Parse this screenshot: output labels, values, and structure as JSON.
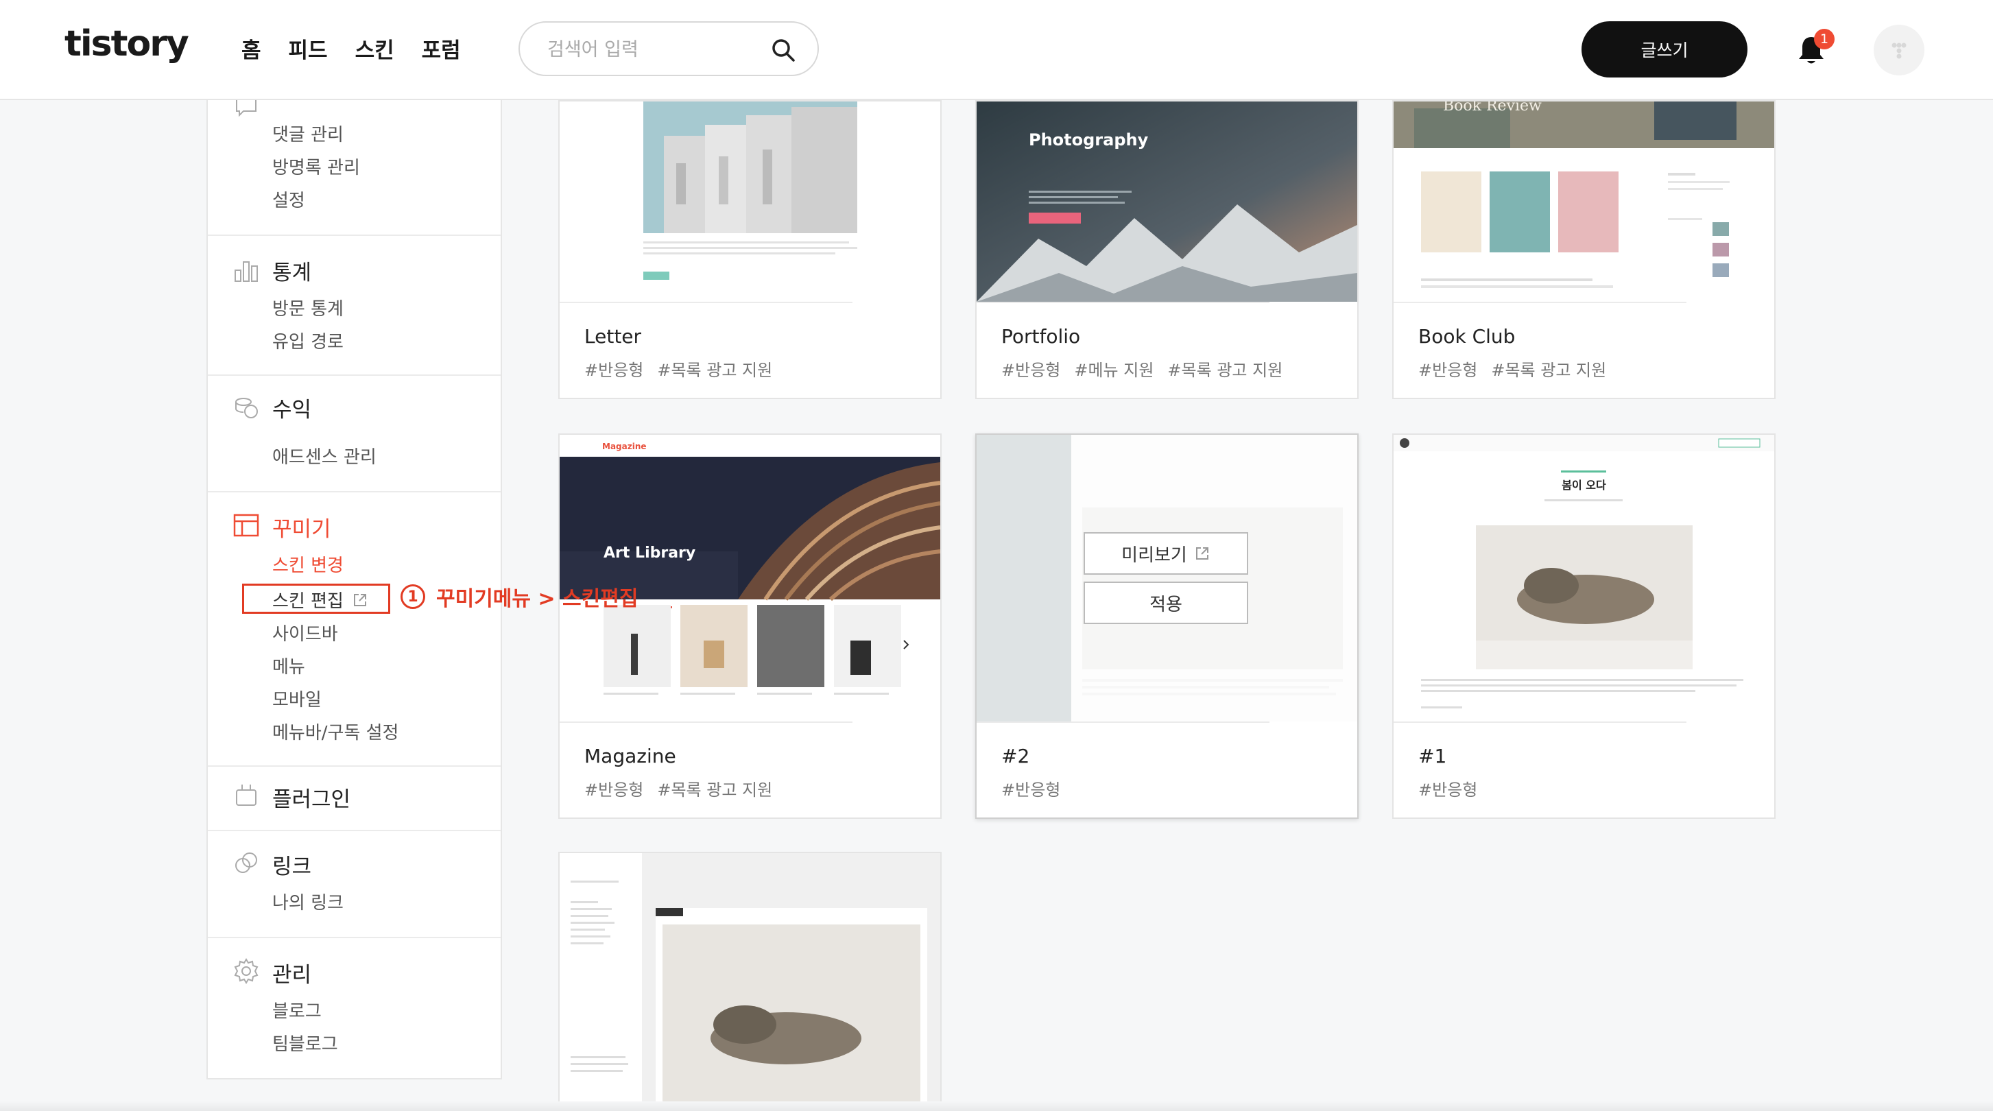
{
  "header": {
    "logo": "tistory",
    "nav": [
      "홈",
      "피드",
      "스킨",
      "포럼"
    ],
    "search_placeholder": "검색어 입력",
    "write_label": "글쓰기",
    "notification_count": "1"
  },
  "sidebar": {
    "top_items": [
      "댓글 관리",
      "방명록 관리",
      "설정"
    ],
    "groups": [
      {
        "title": "통계",
        "items": [
          "방문 통계",
          "유입 경로"
        ]
      },
      {
        "title": "수익",
        "items": [
          "애드센스 관리"
        ]
      },
      {
        "title": "꾸미기",
        "items": [
          "스킨 변경",
          "스킨 편집",
          "사이드바",
          "메뉴",
          "모바일",
          "메뉴바/구독 설정"
        ]
      },
      {
        "title": "플러그인",
        "items": []
      },
      {
        "title": "링크",
        "items": [
          "나의 링크"
        ]
      },
      {
        "title": "관리",
        "items": [
          "블로그",
          "팀블로그"
        ]
      }
    ]
  },
  "annotation": {
    "number": "1",
    "text": "꾸미기메뉴 > 스킨편집"
  },
  "cards": [
    {
      "name": "Letter",
      "tags": [
        "#반응형",
        "#목록 광고 지원"
      ]
    },
    {
      "name": "Portfolio",
      "tags": [
        "#반응형",
        "#메뉴 지원",
        "#목록 광고 지원"
      ],
      "thumb_title": "Photography"
    },
    {
      "name": "Book Club",
      "tags": [
        "#반응형",
        "#목록 광고 지원"
      ],
      "thumb_title": "Book Review"
    },
    {
      "name": "Magazine",
      "tags": [
        "#반응형",
        "#목록 광고 지원"
      ],
      "thumb_title": "Art Library",
      "thumb_brand": "Magazine"
    },
    {
      "name": "#2",
      "tags": [
        "#반응형"
      ]
    },
    {
      "name": "#1",
      "tags": [
        "#반응형"
      ],
      "thumb_title": "봄이 오다"
    }
  ],
  "overlay": {
    "preview_label": "미리보기",
    "apply_label": "적용"
  },
  "colors": {
    "accent": "#ef4b33",
    "annotation": "#e23b23",
    "write_button": "#111111"
  }
}
